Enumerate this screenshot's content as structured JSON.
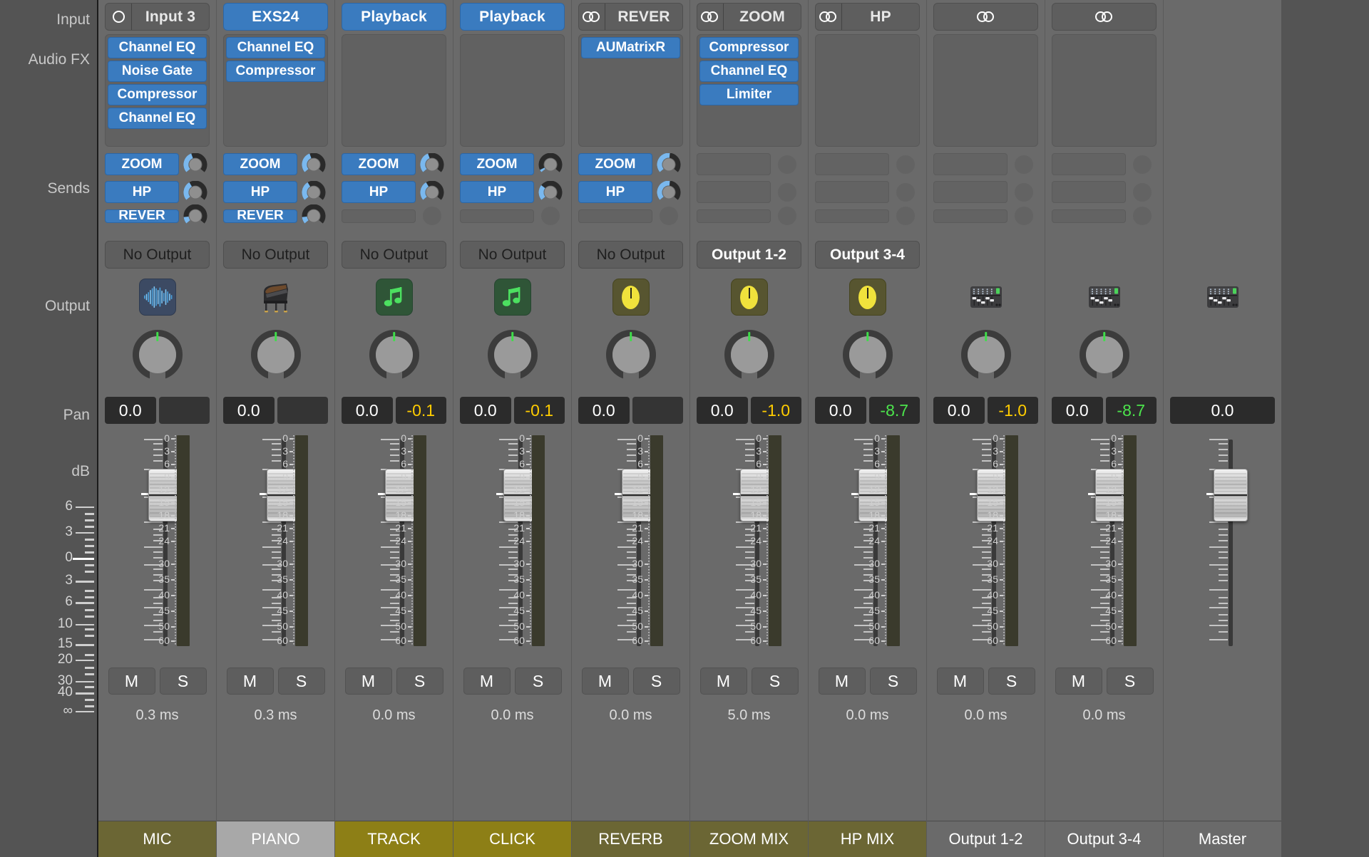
{
  "row_labels": {
    "input": "Input",
    "audio_fx": "Audio FX",
    "sends": "Sends",
    "output": "Output",
    "pan": "Pan",
    "db": "dB"
  },
  "buttons": {
    "mute": "M",
    "solo": "S"
  },
  "colors": {
    "plugin_blue": "#3a7bbf",
    "peak_yellow": "#ffcc00",
    "peak_green": "#4ce44c",
    "pan_indicator_green": "#3fdd4a",
    "name_olive_dark": "#6b6634",
    "name_olive_bright": "#8d7f16",
    "name_gray_light": "#a8a8a8",
    "name_gray": "#6a6a6a"
  },
  "fader_scale": {
    "labels": [
      "6",
      "3",
      "0",
      "3",
      "6",
      "10",
      "15",
      "20",
      "30",
      "40",
      "∞"
    ]
  },
  "meter_scale": {
    "labels": [
      "0",
      "3",
      "6",
      "9",
      "12",
      "15",
      "18",
      "21",
      "24",
      "30",
      "35",
      "40",
      "45",
      "50",
      "60"
    ]
  },
  "channels": [
    {
      "name": "MIC",
      "name_color": "#6b6634",
      "input": {
        "kind": "rec",
        "label": "Input 3",
        "icon": "record-circle-icon",
        "active": false
      },
      "fx": [
        "Channel EQ",
        "Noise Gate",
        "Compressor",
        "Channel EQ"
      ],
      "sends": [
        {
          "label": "ZOOM",
          "amount": 0.42
        },
        {
          "label": "HP",
          "amount": 0.38
        },
        {
          "label": "REVER",
          "amount": 0.13
        }
      ],
      "output": {
        "label": "No Output",
        "style": "noout"
      },
      "icon": "waveform-icon",
      "pan": true,
      "volume": "0.0",
      "peak": "",
      "peak_color": "",
      "mute_solo": true,
      "latency": "0.3 ms",
      "meter": true
    },
    {
      "name": "PIANO",
      "name_color": "#a8a8a8",
      "input": {
        "kind": "plugin",
        "label": "EXS24",
        "active": true
      },
      "fx": [
        "Channel EQ",
        "Compressor"
      ],
      "sends": [
        {
          "label": "ZOOM",
          "amount": 0.42
        },
        {
          "label": "HP",
          "amount": 0.38
        },
        {
          "label": "REVER",
          "amount": 0.13
        }
      ],
      "output": {
        "label": "No Output",
        "style": "noout"
      },
      "icon": "grand-piano-icon",
      "pan": true,
      "volume": "0.0",
      "peak": "",
      "peak_color": "",
      "mute_solo": true,
      "latency": "0.3 ms",
      "meter": true
    },
    {
      "name": "TRACK",
      "name_color": "#8d7f16",
      "input": {
        "kind": "plugin",
        "label": "Playback",
        "active": true
      },
      "fx": [],
      "sends": [
        {
          "label": "ZOOM",
          "amount": 0.42
        },
        {
          "label": "HP",
          "amount": 0.38
        },
        {
          "label": "",
          "amount": 0
        }
      ],
      "output": {
        "label": "No Output",
        "style": "noout"
      },
      "icon": "music-note-icon",
      "pan": true,
      "volume": "0.0",
      "peak": "-0.1",
      "peak_color": "#ffcc00",
      "mute_solo": true,
      "latency": "0.0 ms",
      "meter": true
    },
    {
      "name": "CLICK",
      "name_color": "#8d7f16",
      "input": {
        "kind": "plugin",
        "label": "Playback",
        "active": true
      },
      "fx": [],
      "sends": [
        {
          "label": "ZOOM",
          "amount": 0.05
        },
        {
          "label": "HP",
          "amount": 0.3
        },
        {
          "label": "",
          "amount": 0
        }
      ],
      "output": {
        "label": "No Output",
        "style": "noout"
      },
      "icon": "music-note-icon",
      "pan": true,
      "volume": "0.0",
      "peak": "-0.1",
      "peak_color": "#ffcc00",
      "mute_solo": true,
      "latency": "0.0 ms",
      "meter": true
    },
    {
      "name": "REVERB",
      "name_color": "#6b6634",
      "input": {
        "kind": "bus",
        "label": "REVER",
        "icon": "stereo-icon"
      },
      "fx": [
        "AUMatrixR"
      ],
      "sends": [
        {
          "label": "ZOOM",
          "amount": 0.52
        },
        {
          "label": "HP",
          "amount": 0.52
        },
        {
          "label": "",
          "amount": 0
        }
      ],
      "output": {
        "label": "No Output",
        "style": "noout"
      },
      "icon": "aux-knob-icon",
      "pan": true,
      "volume": "0.0",
      "peak": "",
      "peak_color": "",
      "mute_solo": true,
      "latency": "0.0 ms",
      "meter": true
    },
    {
      "name": "ZOOM MIX",
      "name_color": "#6b6634",
      "input": {
        "kind": "bus",
        "label": "ZOOM",
        "icon": "stereo-icon"
      },
      "fx": [
        "Compressor",
        "Channel EQ",
        "Limiter"
      ],
      "sends": [
        {
          "label": "",
          "amount": 0
        },
        {
          "label": "",
          "amount": 0
        },
        {
          "label": "",
          "amount": 0
        }
      ],
      "output": {
        "label": "Output 1-2",
        "style": "named"
      },
      "icon": "aux-knob-icon",
      "pan": true,
      "volume": "0.0",
      "peak": "-1.0",
      "peak_color": "#ffcc00",
      "mute_solo": true,
      "latency": "5.0 ms",
      "meter": true
    },
    {
      "name": "HP MIX",
      "name_color": "#6b6634",
      "input": {
        "kind": "bus",
        "label": "HP",
        "icon": "stereo-icon"
      },
      "fx": [],
      "sends": [
        {
          "label": "",
          "amount": 0
        },
        {
          "label": "",
          "amount": 0
        },
        {
          "label": "",
          "amount": 0
        }
      ],
      "output": {
        "label": "Output 3-4",
        "style": "named"
      },
      "icon": "aux-knob-icon",
      "pan": true,
      "volume": "0.0",
      "peak": "-8.7",
      "peak_color": "#4ce44c",
      "mute_solo": true,
      "latency": "0.0 ms",
      "meter": true
    },
    {
      "name": "Output 1-2",
      "name_color": "#6a6a6a",
      "input": {
        "kind": "bus",
        "label": "",
        "icon": "stereo-icon"
      },
      "fx": [],
      "sends": [
        {
          "label": "",
          "amount": 0
        },
        {
          "label": "",
          "amount": 0
        },
        {
          "label": "",
          "amount": 0
        }
      ],
      "output": {
        "label": "",
        "style": "none"
      },
      "icon": "mixer-console-icon",
      "pan": true,
      "volume": "0.0",
      "peak": "-1.0",
      "peak_color": "#ffcc00",
      "mute_solo": true,
      "latency": "0.0 ms",
      "meter": true
    },
    {
      "name": "Output 3-4",
      "name_color": "#6a6a6a",
      "input": {
        "kind": "bus",
        "label": "",
        "icon": "stereo-icon"
      },
      "fx": [],
      "sends": [
        {
          "label": "",
          "amount": 0
        },
        {
          "label": "",
          "amount": 0
        },
        {
          "label": "",
          "amount": 0
        }
      ],
      "output": {
        "label": "",
        "style": "none"
      },
      "icon": "mixer-console-icon",
      "pan": true,
      "volume": "0.0",
      "peak": "-8.7",
      "peak_color": "#4ce44c",
      "mute_solo": true,
      "latency": "0.0 ms",
      "meter": true
    },
    {
      "name": "Master",
      "name_color": "#6a6a6a",
      "input": {
        "kind": "none",
        "label": ""
      },
      "fx": [],
      "sends": [],
      "output": {
        "label": "",
        "style": "none"
      },
      "icon": "mixer-console-icon",
      "pan": false,
      "volume": "0.0",
      "peak": "",
      "peak_color": "",
      "mute_solo": false,
      "latency": "",
      "meter": false
    }
  ]
}
